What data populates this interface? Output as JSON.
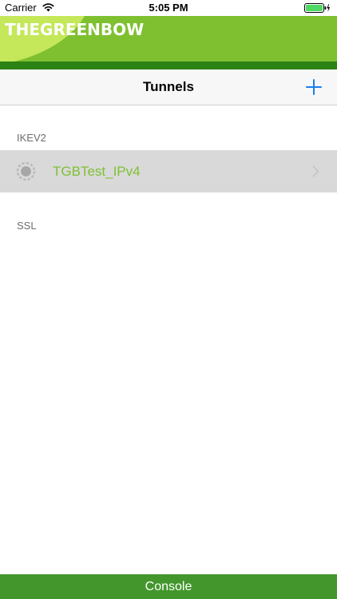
{
  "status_bar": {
    "carrier": "Carrier",
    "time": "5:05 PM"
  },
  "banner": {
    "brand": "THEGREENBOW"
  },
  "nav": {
    "title": "Tunnels",
    "add_icon": "plus-icon"
  },
  "sections": [
    {
      "header": "IKEV2",
      "tunnels": [
        {
          "name": "TGBTest_IPv4",
          "status_icon": "status-ring-icon"
        }
      ]
    },
    {
      "header": "SSL",
      "tunnels": []
    }
  ],
  "console": {
    "label": "Console"
  },
  "colors": {
    "brand_green": "#7fc031",
    "dark_green": "#2c8215",
    "console_green": "#43962c",
    "ios_blue": "#1b7cf0",
    "row_selected": "#d9d9d9"
  }
}
